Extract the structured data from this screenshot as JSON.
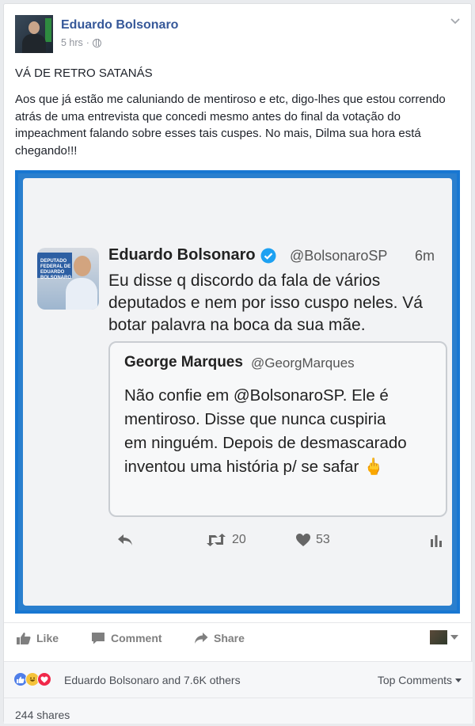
{
  "post": {
    "author": "Eduardo Bolsonaro",
    "time": "5 hrs",
    "separator": "·",
    "headline": "VÁ DE RETRO SATANÁS",
    "body": "Aos que já estão me caluniando de mentiroso e etc, digo-lhes que estou correndo atrás de uma entrevista que concedi mesmo antes do final da votação do impeachment falando sobre esses tais cuspes. No mais, Dilma sua hora está chegando!!!"
  },
  "tweet": {
    "avatar_banner_text": "DEPUTADO FEDERAL DE EDUARDO BOLSONARO",
    "author": "Eduardo Bolsonaro",
    "handle": "@BolsonaroSP",
    "time": "6m",
    "text": "Eu disse q discordo da fala de vários deputados e nem por isso cuspo neles. Vá botar palavra na boca da sua mãe.",
    "quote": {
      "author": "George Marques",
      "handle": "@GeorgMarques",
      "text": "Não confie em @BolsonaroSP. Ele é mentiroso. Disse que nunca cuspiria em ninguém. Depois de desmascarado inventou uma história p/ se safar 🖕"
    },
    "retweets": "20",
    "likes": "53"
  },
  "actions": {
    "like": "Like",
    "comment": "Comment",
    "share": "Share"
  },
  "footer": {
    "reactions_text": "Eduardo Bolsonaro and 7.6K others",
    "top_comments": "Top Comments",
    "shares": "244 shares"
  },
  "colors": {
    "facebook_blue": "#365899",
    "frame_blue": "#1877d2",
    "verified_blue": "#1da1f2"
  }
}
